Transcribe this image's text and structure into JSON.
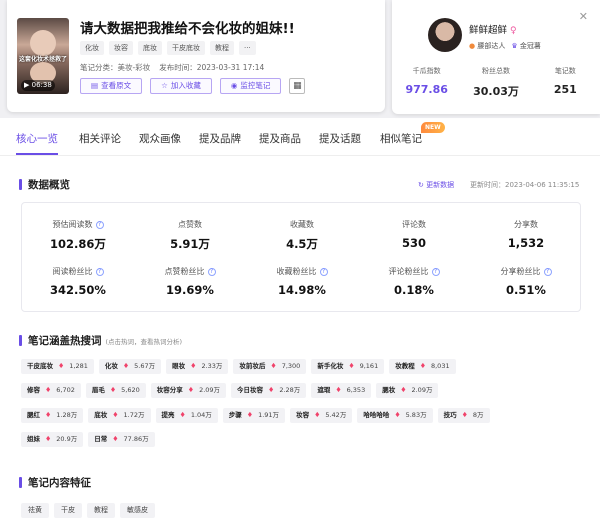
{
  "note": {
    "title": "请大数据把我推给不会化妆的姐妹!!",
    "thumb_caption": "这套化妆术拯救了你",
    "duration": "06:38",
    "tags": [
      "化妆",
      "妆容",
      "底妆",
      "干皮底妆",
      "教程",
      "···"
    ],
    "category": "笔记分类：美妆-彩妆",
    "publish_time": "发布时间：2023-03-31 17:14",
    "buttons": {
      "view": "查看原文",
      "collect": "加入收藏",
      "monitor": "监控笔记"
    }
  },
  "author": {
    "name": "鲜鲜超鲜",
    "sex_icon": "female-icon",
    "badge1": "腰部达人",
    "badge2": "金冠薯",
    "stats": [
      {
        "label": "千瓜指数",
        "value": "977.86",
        "accent": true
      },
      {
        "label": "粉丝总数",
        "value": "30.03万",
        "accent": false
      },
      {
        "label": "笔记数",
        "value": "251",
        "accent": false
      }
    ]
  },
  "tabs": [
    "核心一览",
    "相关评论",
    "观众画像",
    "提及品牌",
    "提及商品",
    "提及话题",
    "相似笔记"
  ],
  "new_badge": "NEW",
  "overview": {
    "title": "数据概览",
    "refresh": "更新数据",
    "updated": "更新时间：2023-04-06 11:35:15",
    "row1": [
      {
        "label": "预估阅读数",
        "value": "102.86万",
        "q": true
      },
      {
        "label": "点赞数",
        "value": "5.91万",
        "q": false
      },
      {
        "label": "收藏数",
        "value": "4.5万",
        "q": false
      },
      {
        "label": "评论数",
        "value": "530",
        "q": false
      },
      {
        "label": "分享数",
        "value": "1,532",
        "q": false
      }
    ],
    "row2": [
      {
        "label": "阅读粉丝比",
        "value": "342.50%"
      },
      {
        "label": "点赞粉丝比",
        "value": "19.69%"
      },
      {
        "label": "收藏粉丝比",
        "value": "14.98%"
      },
      {
        "label": "评论粉丝比",
        "value": "0.18%"
      },
      {
        "label": "分享粉丝比",
        "value": "0.51%"
      }
    ]
  },
  "keywords": {
    "title": "笔记涵盖热搜词",
    "hint": "(点击热词，查看热词分析)",
    "rows": [
      [
        [
          "干皮底妆",
          "1,281"
        ],
        [
          "化妆",
          "5.67万"
        ],
        [
          "眼妆",
          "2.33万"
        ],
        [
          "妆前妆后",
          "7,300"
        ],
        [
          "新手化妆",
          "9,161"
        ],
        [
          "妆教程",
          "8,031"
        ]
      ],
      [
        [
          "修容",
          "6,702"
        ],
        [
          "眉毛",
          "5,620"
        ],
        [
          "妆容分享",
          "2.09万"
        ],
        [
          "今日妆容",
          "2.28万"
        ],
        [
          "遮瑕",
          "6,353"
        ],
        [
          "腮妆",
          "2.09万"
        ]
      ],
      [
        [
          "腮红",
          "1.28万"
        ],
        [
          "底妆",
          "1.72万"
        ],
        [
          "提亮",
          "1.04万"
        ],
        [
          "步骤",
          "1.91万"
        ],
        [
          "妆容",
          "5.42万"
        ],
        [
          "哈哈哈哈",
          "5.83万"
        ],
        [
          "技巧",
          "8万"
        ]
      ],
      [
        [
          "姐妹",
          "20.9万"
        ],
        [
          "日常",
          "77.86万"
        ]
      ]
    ]
  },
  "features": {
    "title": "笔记内容特征",
    "tags": [
      "祛黄",
      "干皮",
      "教程",
      "敏感皮"
    ]
  }
}
